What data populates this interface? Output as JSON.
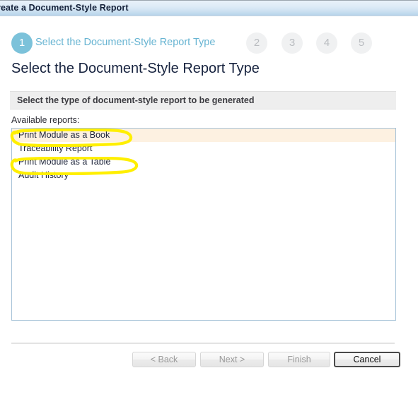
{
  "window": {
    "title": "reate a Document-Style Report"
  },
  "wizard": {
    "steps": [
      {
        "number": "1",
        "label": "Select the Document-Style Report Type",
        "state": "active"
      },
      {
        "number": "2",
        "label": "",
        "state": "inactive"
      },
      {
        "number": "3",
        "label": "",
        "state": "inactive"
      },
      {
        "number": "4",
        "label": "",
        "state": "inactive"
      },
      {
        "number": "5",
        "label": "",
        "state": "inactive"
      }
    ],
    "active_step_color": "#7cc2da",
    "active_step_label_color": "#67b4d2",
    "inactive_step_color": "#f0f1f2"
  },
  "page": {
    "title": "Select the Document-Style Report Type",
    "subtitle": "Select the type of document-style report to be generated"
  },
  "reports": {
    "label": "Available reports:",
    "selected_index": 0,
    "selected_row_color": "#fdf1e1",
    "items": [
      {
        "name": "Print Module as a Book",
        "selected": true,
        "annotated": true
      },
      {
        "name": "Traceability Report",
        "selected": false,
        "annotated": false
      },
      {
        "name": "Print Module as a Table",
        "selected": false,
        "annotated": true
      },
      {
        "name": "Audit History",
        "selected": false,
        "annotated": false
      }
    ]
  },
  "annotations": {
    "color": "#ffef00",
    "shapes": [
      {
        "target": "Print Module as a Book",
        "type": "hand-drawn-oval"
      },
      {
        "target": "Print Module as a Table",
        "type": "hand-drawn-oval"
      }
    ]
  },
  "footer": {
    "buttons": [
      {
        "label": "< Back",
        "state": "disabled"
      },
      {
        "label": "Next >",
        "state": "disabled"
      },
      {
        "label": "Finish",
        "state": "disabled"
      },
      {
        "label": "Cancel",
        "state": "focused"
      }
    ]
  }
}
